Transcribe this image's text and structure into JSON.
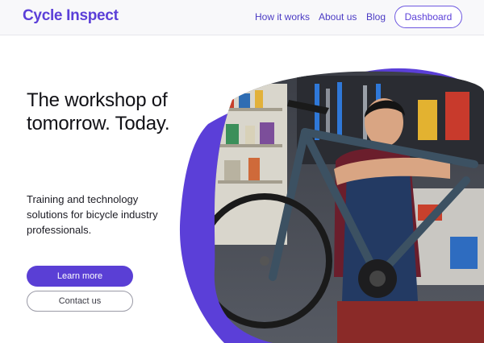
{
  "header": {
    "logo": "Cycle Inspect",
    "nav": [
      {
        "label": "How it works"
      },
      {
        "label": "About us"
      },
      {
        "label": "Blog"
      }
    ],
    "dashboard_label": "Dashboard"
  },
  "hero": {
    "title": "The workshop of tomorrow. Today.",
    "subtitle": "Training and technology solutions for bicycle industry professionals.",
    "primary_cta": "Learn more",
    "secondary_cta": "Contact us",
    "image_description": "Smiling mechanic leaning on a road bicycle in a workshop",
    "accent_color": "#5b3fd8"
  }
}
